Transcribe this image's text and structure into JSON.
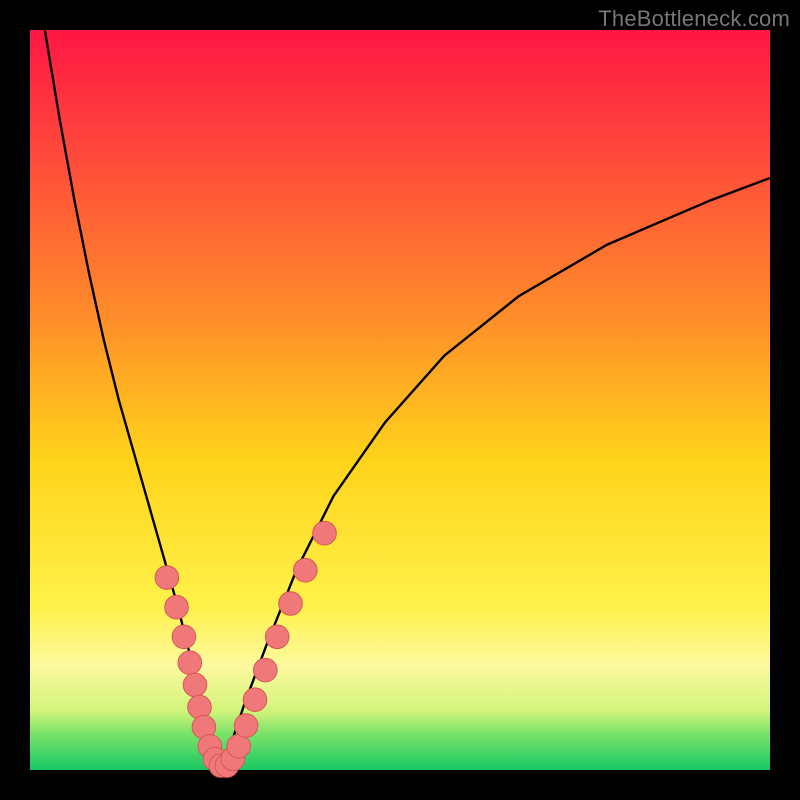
{
  "watermark": "TheBottleneck.com",
  "colors": {
    "frame": "#000000",
    "curve": "#000000",
    "dot_fill": "#f07878",
    "dot_stroke": "#d85858",
    "gradient_stops": [
      {
        "pct": 0,
        "color": "#ff1744"
      },
      {
        "pct": 18,
        "color": "#ff4d3a"
      },
      {
        "pct": 38,
        "color": "#ff8a2a"
      },
      {
        "pct": 58,
        "color": "#ffd31a"
      },
      {
        "pct": 78,
        "color": "#fff24a"
      },
      {
        "pct": 86,
        "color": "#fdf9a0"
      },
      {
        "pct": 92,
        "color": "#d2f47a"
      },
      {
        "pct": 95,
        "color": "#7de36a"
      },
      {
        "pct": 100,
        "color": "#18c864"
      }
    ]
  },
  "chart_data": {
    "type": "line",
    "title": "",
    "xlabel": "",
    "ylabel": "",
    "x_range": [
      0,
      100
    ],
    "y_range": [
      0,
      100
    ],
    "note": "Axes are unlabeled in the source image; x and y are expressed as percent of the plot area (left→right, bottom→top). Curve values estimated from pixel positions.",
    "series": [
      {
        "name": "left-branch",
        "x": [
          2,
          4,
          6,
          8,
          10,
          12,
          14,
          16,
          18,
          20,
          22,
          23,
          24,
          25,
          25.8
        ],
        "y": [
          100,
          88,
          77,
          67,
          58,
          50,
          43,
          36,
          29,
          22,
          14,
          9,
          5,
          2,
          0
        ]
      },
      {
        "name": "right-branch",
        "x": [
          25.8,
          27,
          29,
          32,
          36,
          41,
          48,
          56,
          66,
          78,
          92,
          100
        ],
        "y": [
          0,
          3,
          9,
          17,
          27,
          37,
          47,
          56,
          64,
          71,
          77,
          80
        ]
      }
    ],
    "scatter": {
      "name": "salmon-dots",
      "points": [
        {
          "x": 18.5,
          "y": 26.0,
          "r": 1.6
        },
        {
          "x": 19.8,
          "y": 22.0,
          "r": 1.6
        },
        {
          "x": 20.8,
          "y": 18.0,
          "r": 1.6
        },
        {
          "x": 21.6,
          "y": 14.5,
          "r": 1.6
        },
        {
          "x": 22.3,
          "y": 11.5,
          "r": 1.6
        },
        {
          "x": 22.9,
          "y": 8.5,
          "r": 1.6
        },
        {
          "x": 23.5,
          "y": 5.8,
          "r": 1.6
        },
        {
          "x": 24.3,
          "y": 3.2,
          "r": 1.6
        },
        {
          "x": 25.0,
          "y": 1.5,
          "r": 1.6
        },
        {
          "x": 25.8,
          "y": 0.6,
          "r": 1.6
        },
        {
          "x": 26.6,
          "y": 0.6,
          "r": 1.6
        },
        {
          "x": 27.4,
          "y": 1.5,
          "r": 1.6
        },
        {
          "x": 28.2,
          "y": 3.2,
          "r": 1.6
        },
        {
          "x": 29.2,
          "y": 6.0,
          "r": 1.6
        },
        {
          "x": 30.4,
          "y": 9.5,
          "r": 1.6
        },
        {
          "x": 31.8,
          "y": 13.5,
          "r": 1.6
        },
        {
          "x": 33.4,
          "y": 18.0,
          "r": 1.6
        },
        {
          "x": 35.2,
          "y": 22.5,
          "r": 1.6
        },
        {
          "x": 37.2,
          "y": 27.0,
          "r": 1.6
        },
        {
          "x": 39.8,
          "y": 32.0,
          "r": 1.6
        }
      ]
    }
  }
}
